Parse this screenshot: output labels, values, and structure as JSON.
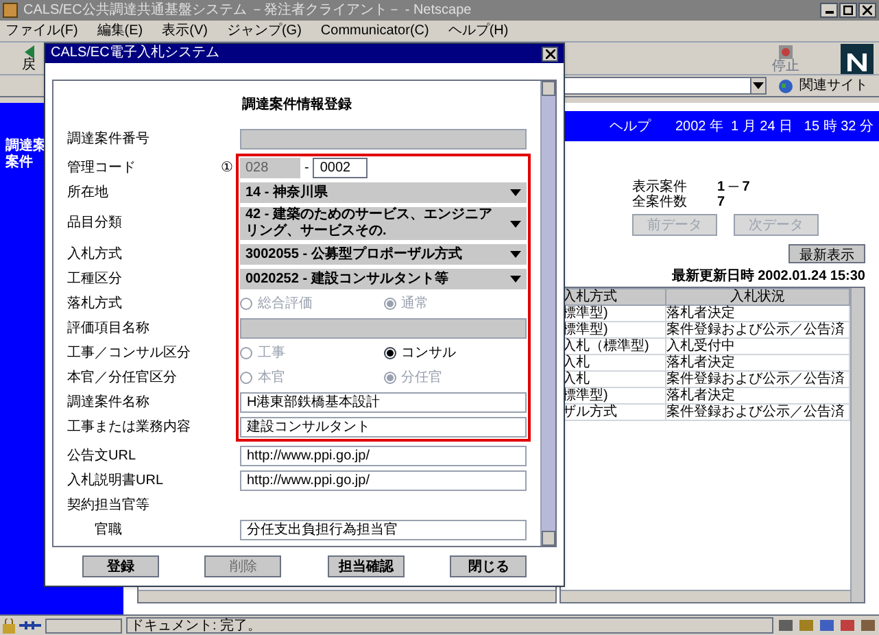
{
  "window": {
    "title": "CALS/EC公共調達共通基盤システム －発注者クライアント－ - Netscape"
  },
  "menu": [
    "ファイル(F)",
    "編集(E)",
    "表示(V)",
    "ジャンプ(G)",
    "Communicator(C)",
    "ヘルプ(H)"
  ],
  "toolbar": {
    "back_label": "戻",
    "stop_label": "停止"
  },
  "location_bar": {
    "related_sites": "関連サイト"
  },
  "sidebar": {
    "lines": [
      "調達案",
      "案件"
    ]
  },
  "header": {
    "help": "ヘルプ",
    "datetime": "2002 年  1 月 24 日   15 時 32 分"
  },
  "summary": [
    {
      "label": "表示案件",
      "value": "1 ─ 7"
    },
    {
      "label": "全案件数",
      "value": "7"
    }
  ],
  "nav_buttons": [
    {
      "label": "前データ",
      "disabled": true
    },
    {
      "label": "次データ",
      "disabled": true
    }
  ],
  "refresh_button": "最新表示",
  "last_updated": "最新更新日時 2002.01.24 15:30",
  "table": {
    "columns": [
      "入札方式",
      "入札状況"
    ],
    "rows": [
      [
        "標準型)",
        "落札者決定"
      ],
      [
        "標準型)",
        "案件登録および公示／公告済"
      ],
      [
        "入札（標準型)",
        "入札受付中"
      ],
      [
        "入札",
        "落札者決定"
      ],
      [
        "入札",
        "案件登録および公示／公告済"
      ],
      [
        "標準型)",
        "落札者決定"
      ],
      [
        "ザル方式",
        "案件登録および公示／公告済"
      ]
    ]
  },
  "status_bar": {
    "text": "ドキュメント: 完了。"
  },
  "dialog": {
    "title": "CALS/EC電子入札システム",
    "heading": "調達案件情報登録",
    "sections": [
      {
        "highlighted": false,
        "fields": [
          {
            "kind": "text",
            "label": "調達案件番号",
            "disabled": true
          }
        ]
      },
      {
        "highlighted": true,
        "fields": [
          {
            "kind": "code",
            "label": "管理コード",
            "info": "①",
            "prefix": "028",
            "separator": "-",
            "value": "0002"
          },
          {
            "kind": "select",
            "label": "所在地",
            "value": "14 - 神奈川県"
          },
          {
            "kind": "select",
            "label": "品目分類",
            "value": "42 - 建築のためのサービス、エンジニアリング、サービスその."
          },
          {
            "kind": "select",
            "label": "入札方式",
            "value": "3002055 - 公募型プロポーザル方式"
          },
          {
            "kind": "select",
            "label": "工種区分",
            "value": "0020252 - 建設コンサルタント等"
          },
          {
            "kind": "radio",
            "label": "落札方式",
            "options": [
              {
                "label": "総合評価",
                "selected": false,
                "disabled": true
              },
              {
                "label": "通常",
                "selected": true,
                "disabled": true
              }
            ]
          },
          {
            "kind": "text",
            "label": "評価項目名称",
            "disabled": true
          },
          {
            "kind": "radio",
            "label": "工事／コンサル区分",
            "options": [
              {
                "label": "工事",
                "selected": false,
                "disabled": true
              },
              {
                "label": "コンサル",
                "selected": true,
                "disabled": false
              }
            ]
          },
          {
            "kind": "radio",
            "label": "本官／分任官区分",
            "options": [
              {
                "label": "本官",
                "selected": false,
                "disabled": true
              },
              {
                "label": "分任官",
                "selected": true,
                "disabled": true
              }
            ]
          },
          {
            "kind": "text",
            "label": "調達案件名称",
            "value": "H港東部鉄橋基本設計",
            "disabled": false
          },
          {
            "kind": "text",
            "label": "工事または業務内容",
            "value": "建設コンサルタント",
            "disabled": false
          }
        ]
      },
      {
        "highlighted": false,
        "fields": [
          {
            "kind": "text",
            "label": "公告文URL",
            "value": "http://www.ppi.go.jp/",
            "disabled": false
          },
          {
            "kind": "text",
            "label": "入札説明書URL",
            "value": "http://www.ppi.go.jp/",
            "disabled": false
          },
          {
            "kind": "section",
            "label": "契約担当官等"
          },
          {
            "kind": "text",
            "label": "官職",
            "indent": true,
            "value": "分任支出負担行為担当官",
            "disabled": false
          }
        ]
      }
    ],
    "buttons": [
      {
        "label": "登録",
        "disabled": false
      },
      {
        "label": "削除",
        "disabled": true
      },
      {
        "label": "担当確認",
        "disabled": false
      },
      {
        "label": "閉じる",
        "disabled": false
      }
    ]
  }
}
